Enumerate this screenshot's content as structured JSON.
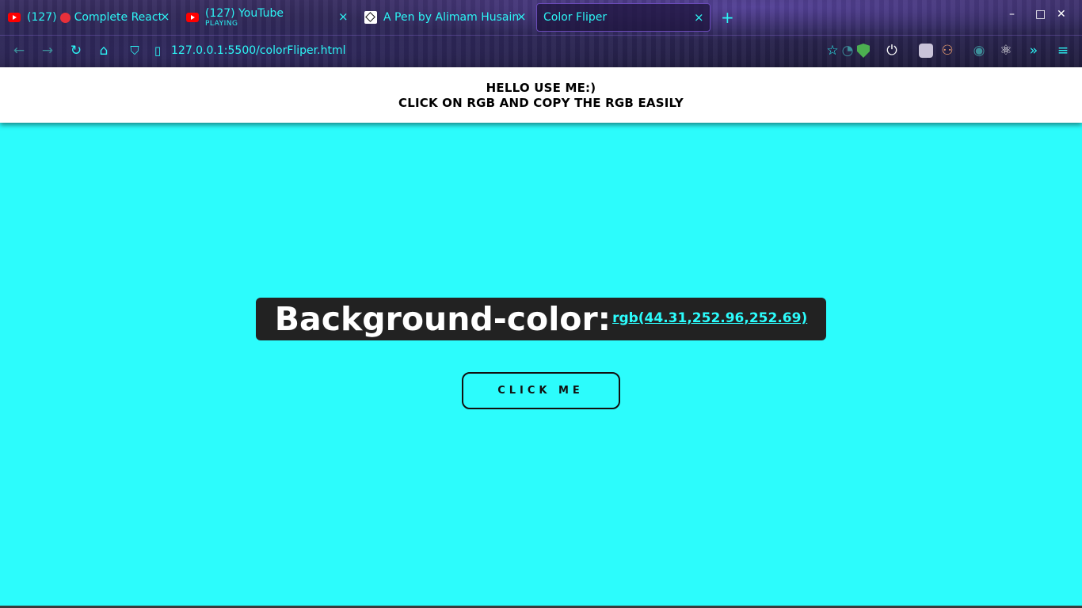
{
  "browser": {
    "tabs": [
      {
        "title": "(127) 🔴 Complete React",
        "count": "(127)",
        "label": "Complete React"
      },
      {
        "title": "(127) YouTube",
        "sub": "PLAYING"
      },
      {
        "title": "A Pen by Alimam Husain"
      },
      {
        "title": "Color Fliper"
      }
    ],
    "new_tab": "+",
    "url": "127.0.0.1:5500/colorFliper.html",
    "window_controls": {
      "minimize": "–",
      "maximize": "□",
      "close": "✕"
    },
    "tab_close": "×"
  },
  "header": {
    "line1": "HELLO USE ME:)",
    "line2": "CLICK ON RGB AND COPY THE RGB EASILY"
  },
  "main": {
    "label": "Background-color:",
    "value": "rgb(44.31,252.96,252.69)",
    "button_label": "CLICK ME"
  },
  "colors": {
    "background": "#2cfcfc",
    "box": "#222222",
    "accent": "#2cf5f5"
  },
  "icons": [
    "youtube-icon",
    "codepen-icon",
    "back-icon",
    "forward-icon",
    "reload-icon",
    "home-icon",
    "shield-icon",
    "page-icon",
    "star-icon",
    "ublock-icon",
    "power-icon",
    "react-devtools-icon",
    "overflow-icon",
    "menu-icon"
  ]
}
